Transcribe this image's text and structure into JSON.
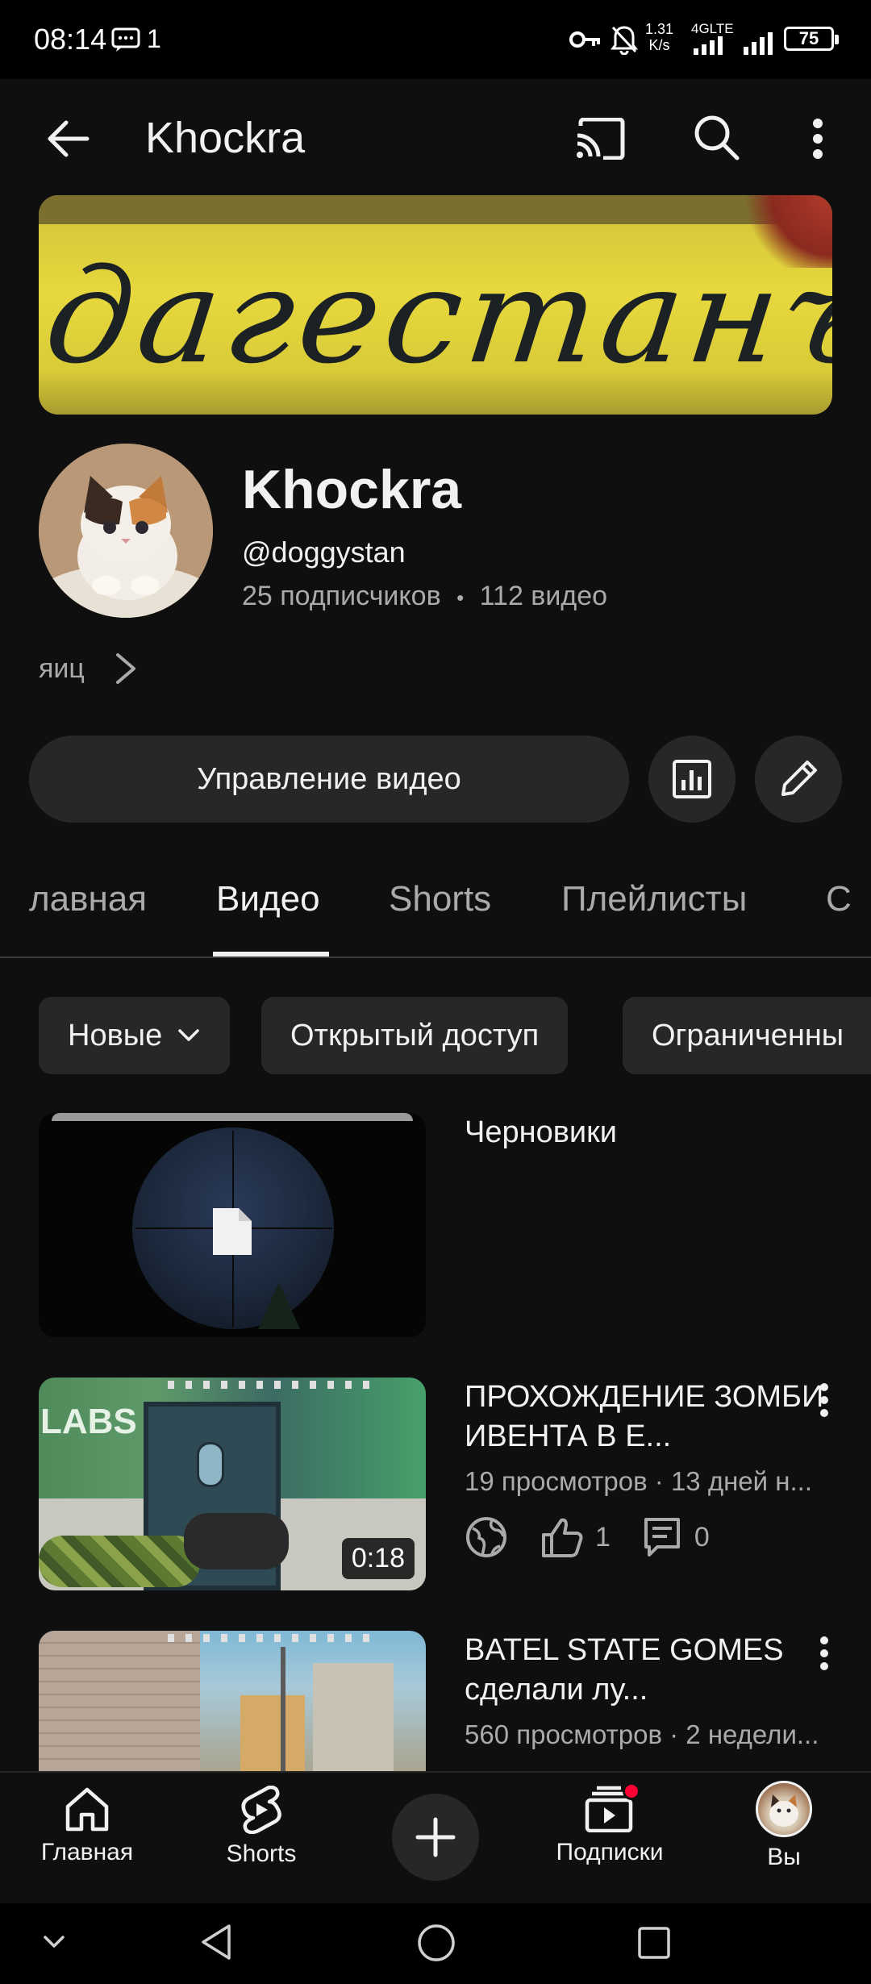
{
  "status_bar": {
    "time": "08:14",
    "notification_count": "1",
    "speed_value": "1.31",
    "speed_unit": "K/s",
    "network": "4GLTE",
    "battery": "75"
  },
  "app_bar": {
    "title": "Khockra"
  },
  "banner": {
    "text": "дагестанъ"
  },
  "channel": {
    "name": "Khockra",
    "handle": "@doggystan",
    "subscribers": "25 подписчиков",
    "separator": "•",
    "video_count": "112 видео",
    "description": "яиц"
  },
  "actions": {
    "manage_videos": "Управление видео"
  },
  "tabs": [
    {
      "label": "лавная"
    },
    {
      "label": "Видео"
    },
    {
      "label": "Shorts"
    },
    {
      "label": "Плейлисты"
    },
    {
      "label": "С"
    }
  ],
  "chips": [
    {
      "label": "Новые"
    },
    {
      "label": "Открытый доступ"
    },
    {
      "label": "Ограниченны"
    }
  ],
  "videos": [
    {
      "title": "Черновики"
    },
    {
      "title": "ПРОХОЖДЕНИЕ ЗОМБИ ИВЕНТА В Е...",
      "meta": "19 просмотров · 13 дней н...",
      "duration": "0:18",
      "likes": "1",
      "comments": "0",
      "thumb_text": "LABS"
    },
    {
      "title": "BATEL STATE GOMES сделали лу...",
      "meta": "560 просмотров · 2 недели..."
    }
  ],
  "bottom_nav": [
    {
      "label": "Главная"
    },
    {
      "label": "Shorts"
    },
    {
      "label": "Подписки"
    },
    {
      "label": "Вы"
    }
  ],
  "colors": {
    "background": "#0f0f0f",
    "surface": "#272727",
    "text_primary": "#f1f1f1",
    "text_secondary": "#aaaaaa",
    "notification_dot": "#ff0033"
  }
}
